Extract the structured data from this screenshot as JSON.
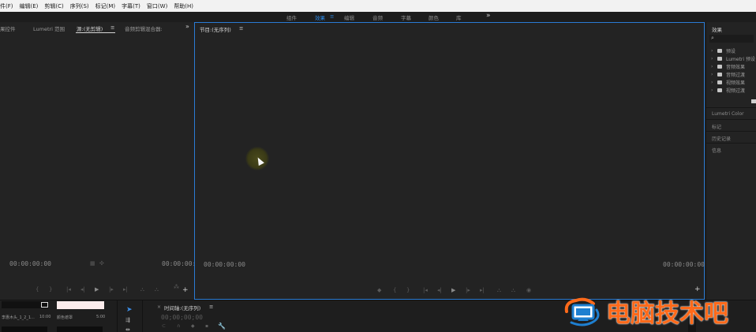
{
  "menu": [
    "件(F)",
    "编辑(E)",
    "剪辑(C)",
    "序列(S)",
    "标记(M)",
    "字幕(T)",
    "窗口(W)",
    "帮助(H)"
  ],
  "workspaces": {
    "items": [
      "组件",
      "效果",
      "编辑",
      "音频",
      "字幕",
      "颜色",
      "库"
    ],
    "active": "效果",
    "active_menu_icon": "≡",
    "more": "»"
  },
  "source_panel": {
    "tabs": [
      "果控件",
      "Lumetri 范围",
      "源:(无剪辑)",
      "音频剪辑混合器:"
    ],
    "active_tab_menu": "≡",
    "overflow": "»",
    "timecode_left": "00:00:00:00",
    "timecode_right": "00:00:00:00"
  },
  "program_panel": {
    "title": "节目:(无序列)",
    "menu": "≡",
    "timecode_left": "00:00:00:00",
    "timecode_right": "00:00:00:00",
    "add": "+"
  },
  "effects_panel": {
    "title": "效果",
    "search_icon": "⌕",
    "items": [
      "预设",
      "Lumetri 预设",
      "音频效果",
      "音频过渡",
      "视频效果",
      "视频过渡"
    ],
    "sections": [
      "Lumetri Color",
      "标记",
      "历史记录",
      "信息"
    ]
  },
  "bottom": {
    "project_item1_name": "李惠木头_1_2_1...",
    "project_item1_duration": "10:00",
    "project_item2_name": "颜色遮罩",
    "project_item2_duration": "5:00",
    "timeline_title": "时间轴:(无序列)",
    "timeline_menu": "≡",
    "timeline_close": "×",
    "timeline_timecode": "00;00;00;00"
  },
  "watermark": {
    "text": "电脑技术吧",
    "color": "#ff6a1a"
  },
  "colors": {
    "accent": "#2d8ceb",
    "program_border": "#2a7bd4",
    "background": "#232323"
  }
}
